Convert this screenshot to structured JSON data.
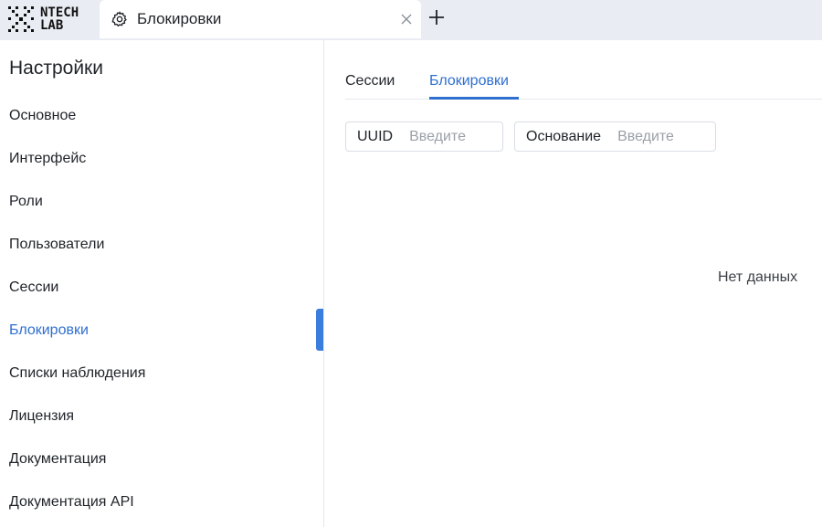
{
  "app": {
    "logo_line1": "NTECH",
    "logo_line2": "LAB",
    "tab_title": "Блокировки",
    "tab_icon": "gear-icon"
  },
  "sidebar": {
    "heading": "Настройки",
    "items": [
      {
        "label": "Основное"
      },
      {
        "label": "Интерфейс"
      },
      {
        "label": "Роли"
      },
      {
        "label": "Пользователи"
      },
      {
        "label": "Сессии"
      },
      {
        "label": "Блокировки",
        "active": true
      },
      {
        "label": "Списки наблюдения"
      },
      {
        "label": "Лицензия"
      },
      {
        "label": "Документация"
      },
      {
        "label": "Документация API"
      }
    ]
  },
  "main": {
    "tabs": [
      {
        "label": "Сессии"
      },
      {
        "label": "Блокировки",
        "active": true
      }
    ],
    "filters": [
      {
        "label": "UUID",
        "value": "",
        "placeholder": "Введите"
      },
      {
        "label": "Основание",
        "value": "",
        "placeholder": "Введите"
      }
    ],
    "empty_text": "Нет данных"
  },
  "colors": {
    "accent": "#2f6fcf",
    "topbar_bg": "#e9ecf2",
    "indicator": "#3b7ddd"
  }
}
